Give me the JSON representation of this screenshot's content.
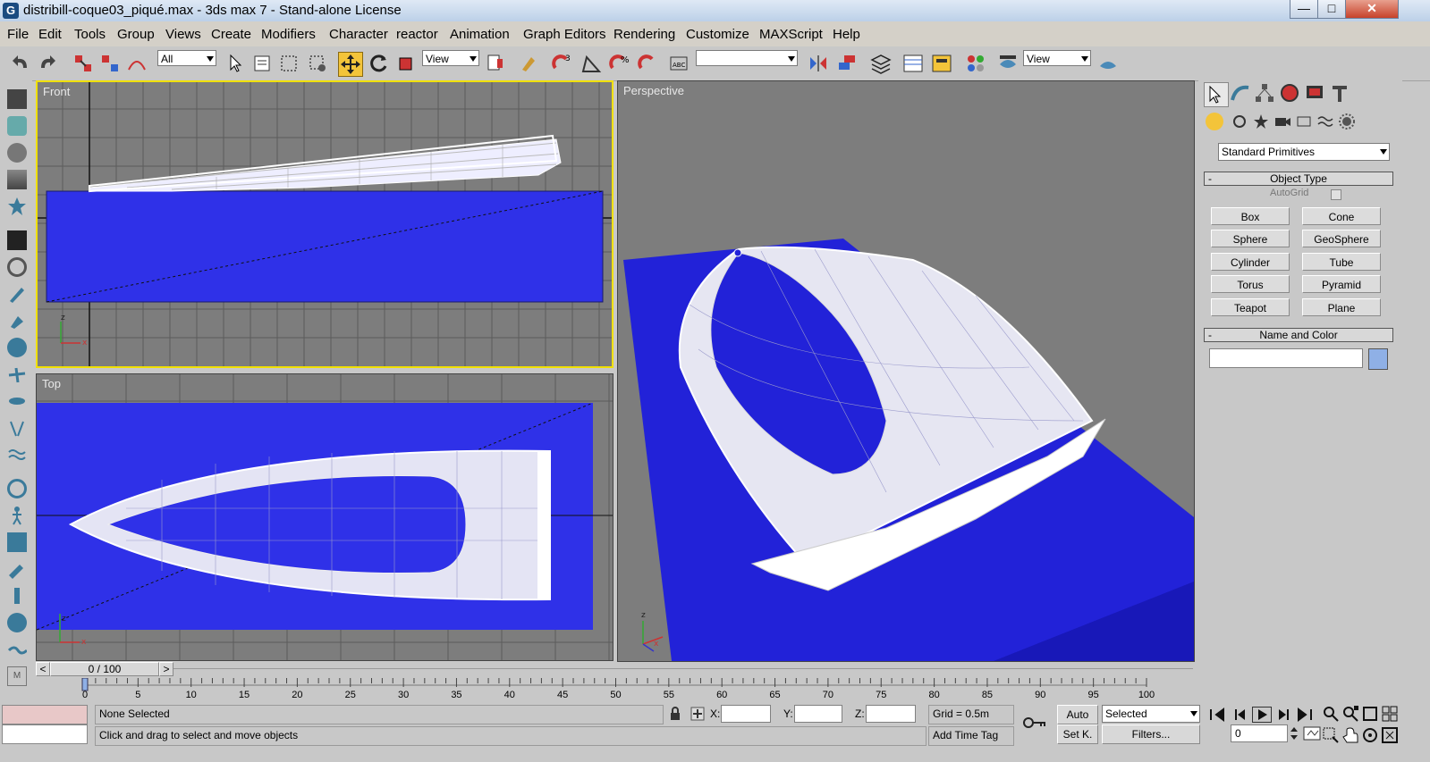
{
  "window": {
    "title": "distribill-coque03_piqué.max - 3ds max 7 - Stand-alone License",
    "minimize": "—",
    "maximize": "□",
    "close": "✕"
  },
  "menu": [
    "File",
    "Edit",
    "Tools",
    "Group",
    "Views",
    "Create",
    "Modifiers",
    "Character",
    "reactor",
    "Animation",
    "Graph Editors",
    "Rendering",
    "Customize",
    "MAXScript",
    "Help"
  ],
  "toolbar": {
    "selection_filter": "All",
    "reference_coord": "View",
    "named_selection": "",
    "render_view": "View"
  },
  "viewports": {
    "front": {
      "label": "Front"
    },
    "top": {
      "label": "Top"
    },
    "perspective": {
      "label": "Perspective"
    },
    "axis_x": "x",
    "axis_z": "z"
  },
  "command_panel": {
    "category": "Standard Primitives",
    "object_type_title": "Object Type",
    "autogrid": "AutoGrid",
    "buttons": [
      "Box",
      "Cone",
      "Sphere",
      "GeoSphere",
      "Cylinder",
      "Tube",
      "Torus",
      "Pyramid",
      "Teapot",
      "Plane"
    ],
    "name_color_title": "Name and Color",
    "object_name": "",
    "object_color": "#8fb0e6",
    "minus": "-"
  },
  "time_slider": {
    "value": "0 / 100",
    "prev": "<",
    "next": ">"
  },
  "trackbar": {
    "ticks": [
      "0",
      "5",
      "10",
      "15",
      "20",
      "25",
      "30",
      "35",
      "40",
      "45",
      "50",
      "55",
      "60",
      "65",
      "70",
      "75",
      "80",
      "85",
      "90",
      "95",
      "100"
    ]
  },
  "status": {
    "selection": "None Selected",
    "prompt": "Click and drag to select and move objects",
    "x_label": "X:",
    "y_label": "Y:",
    "z_label": "Z:",
    "x_value": "",
    "y_value": "",
    "z_value": "",
    "grid": "Grid = 0.5m",
    "add_time_tag": "Add Time Tag",
    "auto_key": "Auto",
    "set_key": "Set K.",
    "key_filter_selected": "Selected",
    "filters": "Filters...",
    "frame": "0"
  },
  "colors": {
    "viewport_bg": "#7d7d7d",
    "blue_plane": "#2f31e8",
    "active_border": "#f0e000"
  }
}
